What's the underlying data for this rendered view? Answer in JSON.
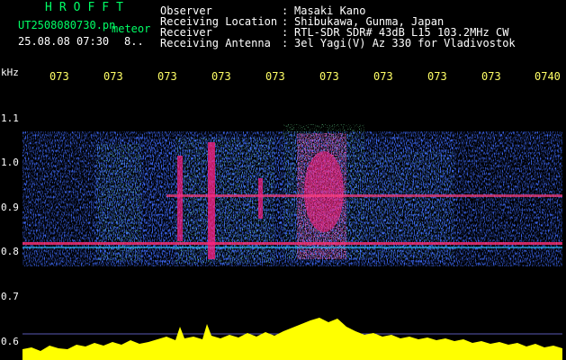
{
  "app": {
    "title": "HROFFT",
    "filename": "UT2508080730.pn",
    "tag": "meteor",
    "datetime": "25.08.08 07:30",
    "count": "8.."
  },
  "info": [
    {
      "label": "Observer",
      "value": "Masaki Kano"
    },
    {
      "label": "Receiving Location",
      "value": "Shibukawa, Gunma, Japan"
    },
    {
      "label": "Receiver",
      "value": "RTL-SDR SDR# 43dB L15 103.2MHz CW"
    },
    {
      "label": "Receiving Antenna",
      "value": "3el Yagi(V) Az 330 for Vladivostok"
    }
  ],
  "axis": {
    "unit": "kHz",
    "y_ticks": [
      "1.1",
      "1.0",
      "0.9",
      "0.8",
      "0.7",
      "0.6"
    ],
    "x_ticks": [
      "073",
      "073",
      "073",
      "073",
      "073",
      "073",
      "073",
      "073",
      "073",
      "0740"
    ]
  },
  "colors": {
    "background": "#000000",
    "header_green": "#00ff66",
    "header_white": "#ffffff",
    "tick_yellow": "#ffff66",
    "signal_magenta": "#ff2080",
    "signal_green": "#30ff60",
    "noise_blue": "#1030ff",
    "amplitude_yellow": "#ffff00"
  }
}
